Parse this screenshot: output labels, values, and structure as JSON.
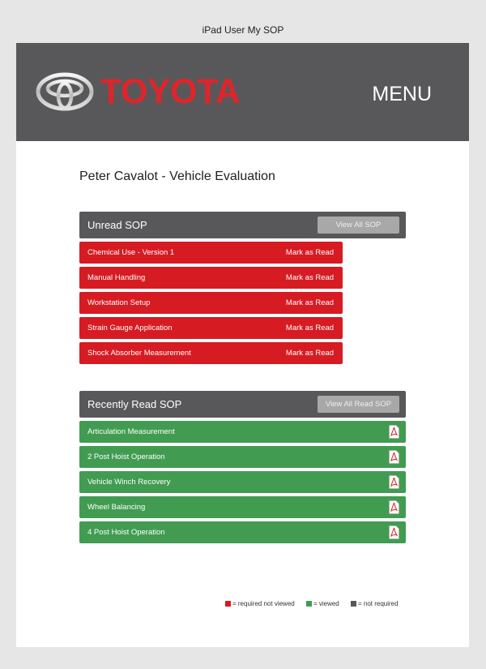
{
  "frame_title": "iPad User My SOP",
  "header": {
    "brand": "TOYOTA",
    "menu_label": "MENU"
  },
  "page_title": "Peter Cavalot - Vehicle Evaluation",
  "unread": {
    "title": "Unread SOP",
    "view_all_label": "View All SOP",
    "mark_label": "Mark as Read",
    "items": [
      {
        "label": "Chemical Use - Version 1"
      },
      {
        "label": "Manual Handling"
      },
      {
        "label": "Workstation Setup"
      },
      {
        "label": "Strain Gauge Application"
      },
      {
        "label": "Shock Absorber Measurement"
      }
    ]
  },
  "recent": {
    "title": "Recently Read SOP",
    "view_all_label": "View All Read SOP",
    "items": [
      {
        "label": "Articulation Measurement"
      },
      {
        "label": "2 Post Hoist Operation"
      },
      {
        "label": "Vehicle Winch Recovery"
      },
      {
        "label": "Wheel Balancing"
      },
      {
        "label": "4 Post Hoist Operation"
      }
    ]
  },
  "legend": {
    "required_not_viewed": "= required not viewed",
    "viewed": "= viewed",
    "not_required": "= not required"
  },
  "colors": {
    "header_bg": "#58585a",
    "brand_red": "#e0242b",
    "unread_red": "#d61b22",
    "viewed_green": "#419c52",
    "button_gray": "#a8a8a8"
  },
  "icons": [
    "toyota-logo",
    "pdf-icon"
  ]
}
